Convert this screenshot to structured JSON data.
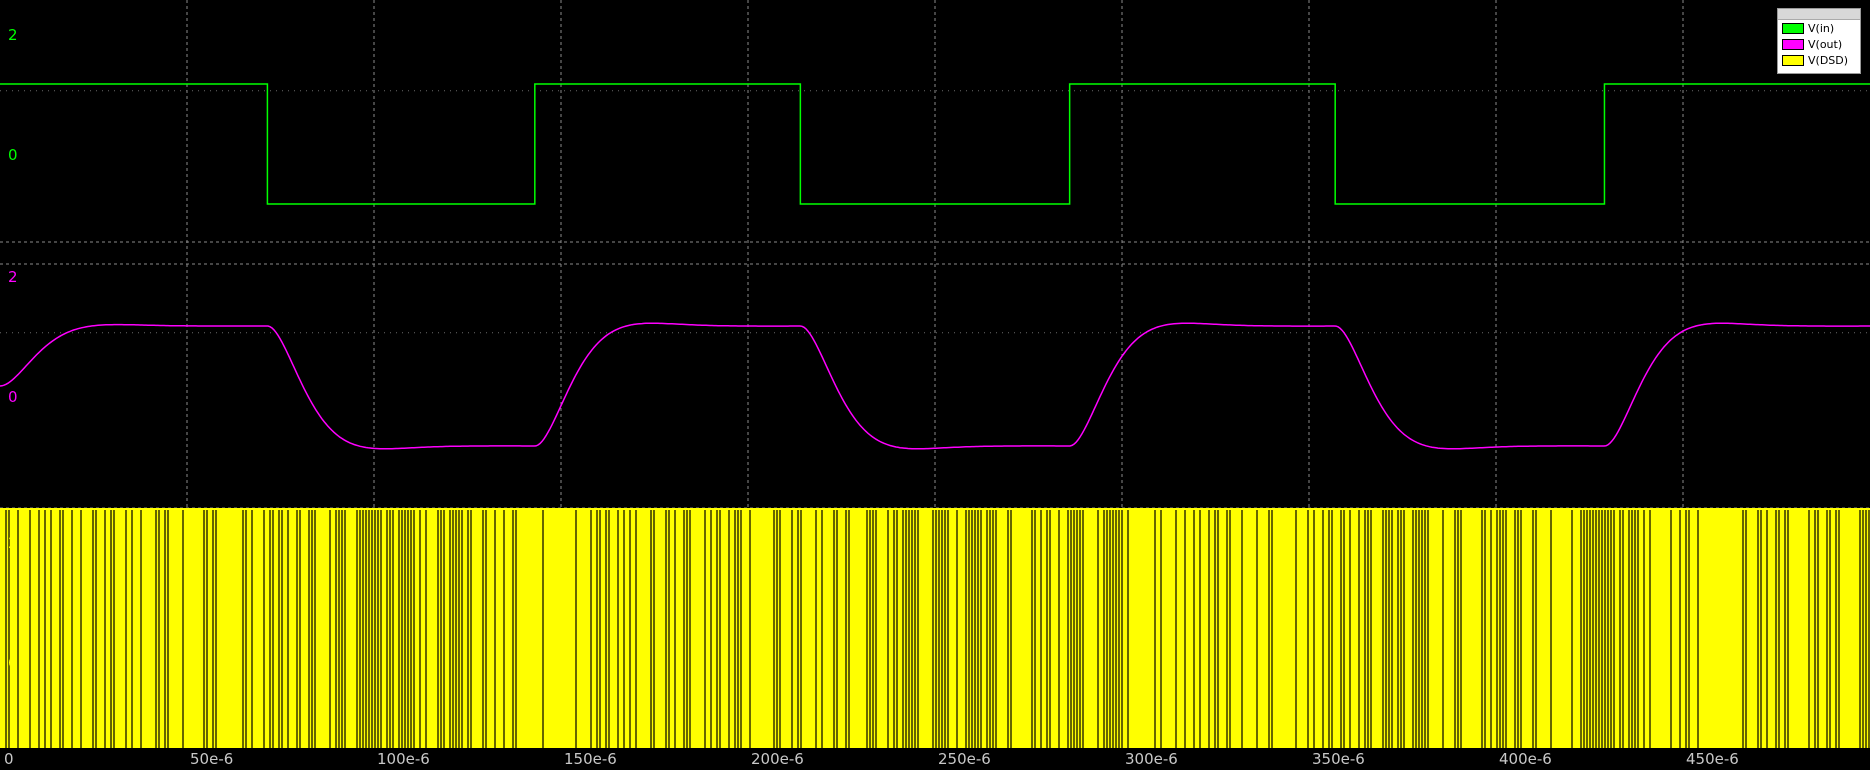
{
  "chart_data": {
    "type": "line",
    "title": "",
    "xlabel": "",
    "x_ticks": [
      "0",
      "50e-6",
      "100e-6",
      "150e-6",
      "200e-6",
      "250e-6",
      "300e-6",
      "350e-6",
      "400e-6",
      "450e-6"
    ],
    "x_tick_values": [
      0,
      5e-05,
      0.0001,
      0.00015,
      0.0002,
      0.00025,
      0.0003,
      0.00035,
      0.0004,
      0.00045
    ],
    "xlim": [
      0,
      0.0005
    ],
    "grid": true,
    "legend_position": "top-right",
    "panels": [
      {
        "series_name": "V(in)",
        "color": "#00ff00",
        "ylim": [
          -2,
          2
        ],
        "y_ticks": [
          "2",
          "0"
        ],
        "y_tick_values": [
          2,
          0
        ],
        "kind": "square",
        "period": 0.000143,
        "first_fall": 7.15e-05,
        "high": 1,
        "low": -1
      },
      {
        "series_name": "V(out)",
        "color": "#ff00ff",
        "ylim": [
          -2,
          2
        ],
        "y_ticks": [
          "2",
          "0"
        ],
        "y_tick_values": [
          2,
          0
        ],
        "kind": "filtered",
        "high": 1,
        "low": -1,
        "overshoot": 0.06,
        "delay": 1.5e-05
      },
      {
        "series_name": "V(DSD)",
        "color": "#ffff00",
        "ylim": [
          -2,
          2
        ],
        "y_ticks": [
          "2",
          "0"
        ],
        "y_tick_values": [
          2,
          0
        ],
        "kind": "pdm",
        "high": 2,
        "low": -2
      }
    ]
  },
  "legend": {
    "items": [
      {
        "label": "V(in)",
        "color": "#00ff00"
      },
      {
        "label": "V(out)",
        "color": "#ff00ff"
      },
      {
        "label": "V(DSD)",
        "color": "#ffff00"
      }
    ]
  }
}
